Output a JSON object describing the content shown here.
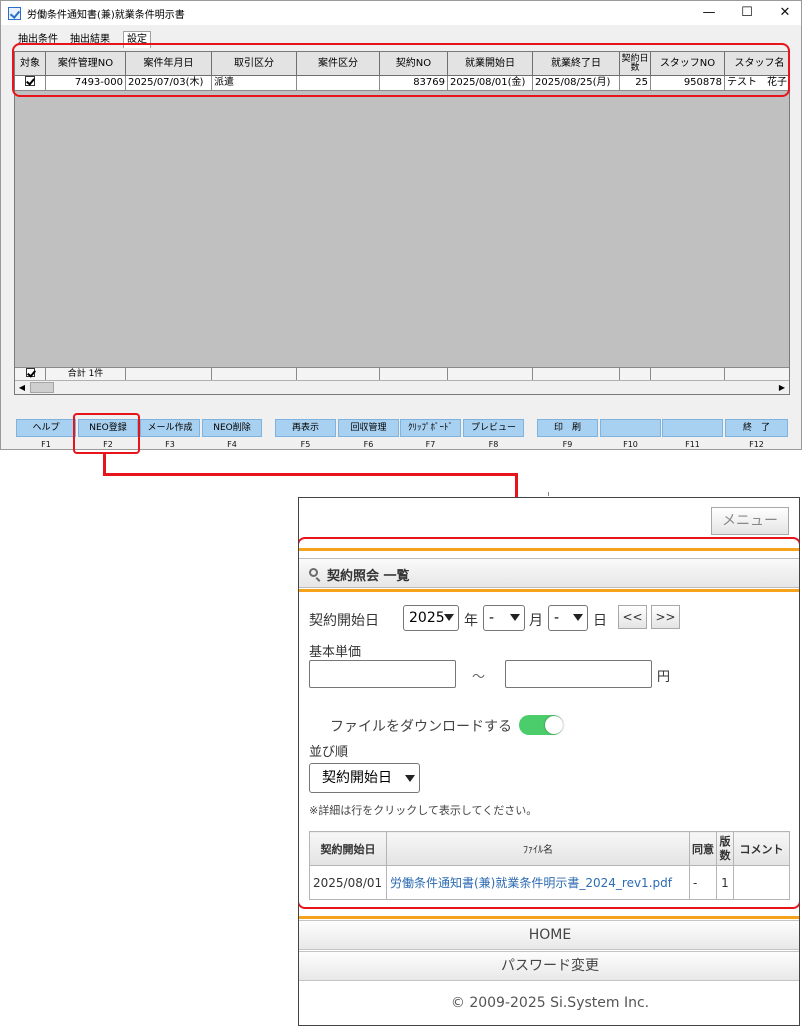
{
  "window": {
    "title": "労働条件通知書(兼)就業条件明示書",
    "controls": {
      "minimize": "—",
      "maximize": "☐",
      "close": "✕"
    }
  },
  "tabs": [
    "抽出条件",
    "抽出結果",
    "設定"
  ],
  "grid": {
    "columns": [
      "対象",
      "案件管理NO",
      "案件年月日",
      "取引区分",
      "案件区分",
      "契約NO",
      "就業開始日",
      "就業終了日",
      "契約日数",
      "スタッフNO",
      "スタッフ名"
    ],
    "row": {
      "checked": true,
      "case_no": "7493-000",
      "case_date": "2025/07/03(木)",
      "transaction_type": "派遣",
      "case_type": "",
      "contract_no": "83769",
      "start_date": "2025/08/01(金)",
      "end_date": "2025/08/25(月)",
      "contract_days": "25",
      "staff_no": "950878",
      "staff_name": "テスト　花子"
    },
    "footer": {
      "checked": true,
      "total": "合計 1件"
    },
    "scroll": {
      "left": "◀",
      "right": "▶"
    }
  },
  "function_keys": [
    {
      "label": "ヘルプ",
      "key": "F1"
    },
    {
      "label": "NEO登録",
      "key": "F2"
    },
    {
      "label": "メール作成",
      "key": "F3"
    },
    {
      "label": "NEO削除",
      "key": "F4"
    },
    {
      "label": "再表示",
      "key": "F5"
    },
    {
      "label": "回収管理",
      "key": "F6"
    },
    {
      "label": "ｸﾘｯﾌﾟﾎﾞｰﾄﾞ",
      "key": "F7"
    },
    {
      "label": "プレビュー",
      "key": "F8"
    },
    {
      "label": "印　刷",
      "key": "F9"
    },
    {
      "label": "",
      "key": "F10"
    },
    {
      "label": "",
      "key": "F11"
    },
    {
      "label": "終　了",
      "key": "F12"
    }
  ],
  "web": {
    "menu_button": "メニュー",
    "section_title": "契約照会 一覧",
    "start_date_label": "契約開始日",
    "year_value": "2025",
    "year_unit": "年",
    "month_value": "-",
    "month_unit": "月",
    "day_value": "-",
    "day_unit": "日",
    "prev_button": "<<",
    "next_button": ">>",
    "unit_price_label": "基本単価",
    "range_sep": "～",
    "currency": "円",
    "download_label": "ファイルをダウンロードする",
    "download_enabled": true,
    "sort_label": "並び順",
    "sort_value": "契約開始日",
    "note": "※詳細は行をクリックして表示してください。",
    "table": {
      "headers": {
        "start": "契約開始日",
        "file": "ﾌｧｲﾙ名",
        "agree": "同意",
        "version": "版数",
        "comment": "コメント"
      },
      "rows": [
        {
          "start": "2025/08/01",
          "file": "労働条件通知書(兼)就業条件明示書_2024_rev1.pdf",
          "agree": "-",
          "version": "1",
          "comment": ""
        }
      ]
    },
    "nav": {
      "home": "HOME",
      "password": "パスワード変更"
    },
    "copyright": "© 2009-2025 Si.System Inc."
  },
  "colors": {
    "highlight": "#e8141b",
    "accent": "#f7a21b",
    "fkey_button": "#a8d0f0",
    "toggle_on": "#4ccd6b",
    "link": "#2d6bb3"
  }
}
